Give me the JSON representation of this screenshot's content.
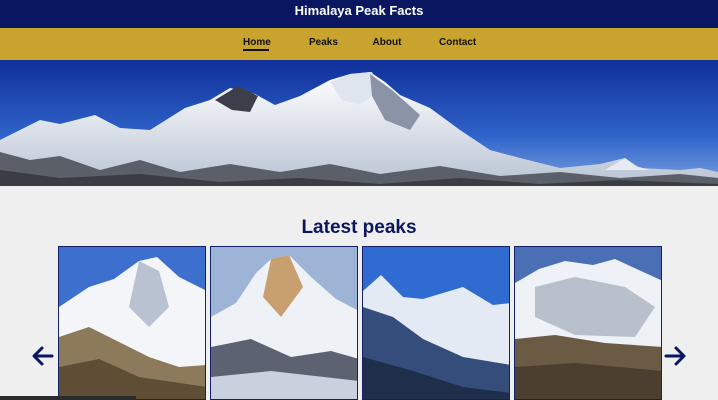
{
  "header": {
    "title": "Himalaya Peak Facts"
  },
  "nav": {
    "items": [
      {
        "label": "Home",
        "active": true
      },
      {
        "label": "Peaks"
      },
      {
        "label": "About"
      },
      {
        "label": "Contact"
      }
    ]
  },
  "main": {
    "section_title": "Latest peaks",
    "carousel": {
      "prev_icon": "arrow-left-icon",
      "next_icon": "arrow-right-icon"
    }
  },
  "colors": {
    "header_bg": "#0a1760",
    "nav_bg": "#c8a42f",
    "heading": "#0a1760"
  }
}
